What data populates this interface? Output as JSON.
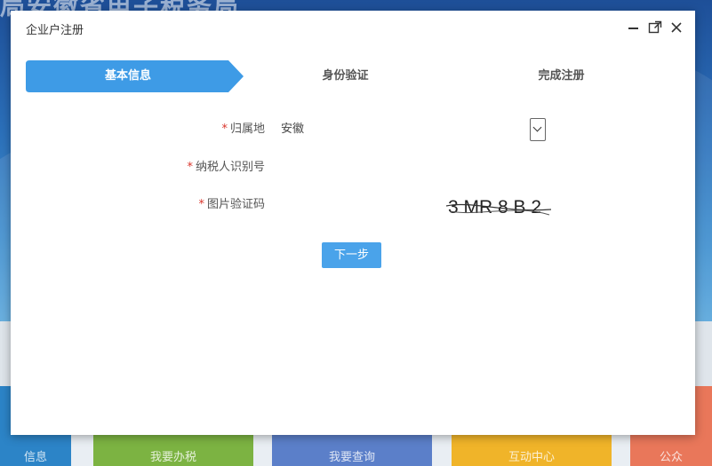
{
  "background": {
    "site_title": "局安徽省电子税务局",
    "tiles": [
      "信息",
      "我要办税",
      "我要查询",
      "互动中心",
      "公众"
    ]
  },
  "modal": {
    "title": "企业户注册",
    "controls": {
      "minimize_icon": "minimize-icon",
      "maximize_icon": "maximize-icon",
      "close_icon": "close-icon"
    }
  },
  "steps": [
    {
      "label": "基本信息",
      "active": true
    },
    {
      "label": "身份验证",
      "active": false
    },
    {
      "label": "完成注册",
      "active": false
    }
  ],
  "form": {
    "required_mark": "*",
    "region": {
      "label": "归属地",
      "value": "安徽"
    },
    "taxpayer_id": {
      "label": "纳税人识别号",
      "value": "",
      "placeholder": ""
    },
    "captcha": {
      "label": "图片验证码",
      "value": "",
      "placeholder": "",
      "image_text": "3 MR 8 B 2"
    }
  },
  "buttons": {
    "next": "下一步"
  },
  "colors": {
    "accent": "#4aa3ea",
    "step_active": "#3e9be6",
    "required": "#d9342b"
  }
}
